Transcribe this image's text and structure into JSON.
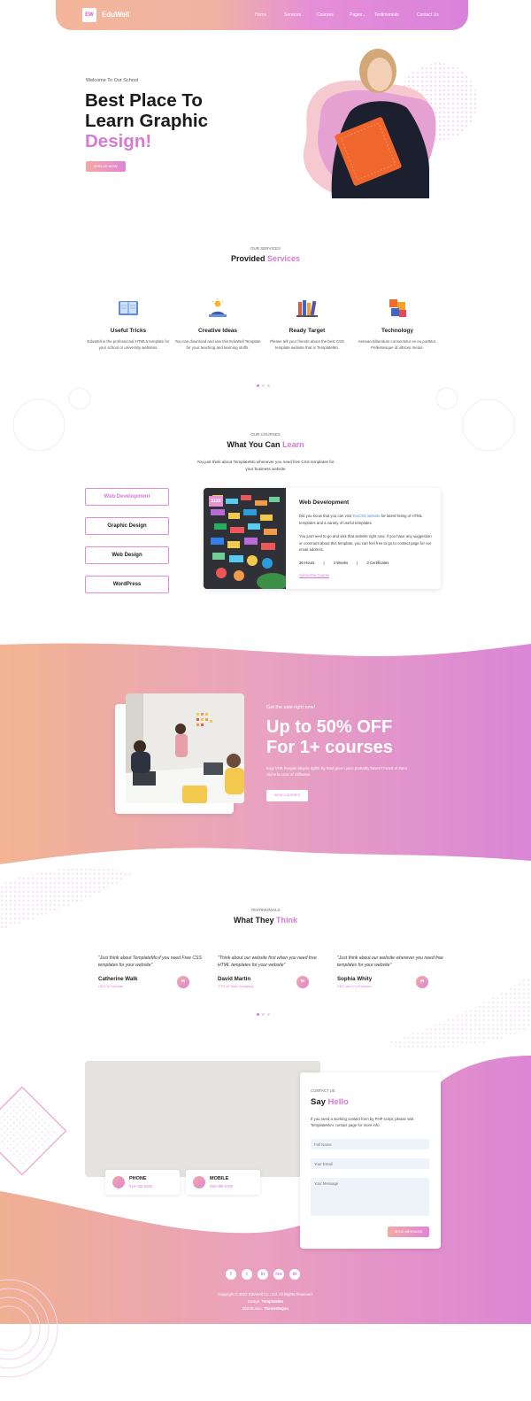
{
  "header": {
    "logo_mark": "EW",
    "brand": "EduWell",
    "nav": [
      "Home",
      "Services",
      "Courses",
      "Pages",
      "Testimonials",
      "Contact Us"
    ]
  },
  "hero": {
    "kicker": "Welcome To Our School",
    "title_line1": "Best Place To",
    "title_line2": "Learn Graphic",
    "title_highlight": "Design!",
    "button": "JOIN US NOW!"
  },
  "services": {
    "kicker": "OUR SERVICES",
    "title": "Provided",
    "title_highlight": "Services",
    "items": [
      {
        "icon": "book-icon",
        "title": "Useful Tricks",
        "text": "EduWell is the professional HTML5 template for your school or university websites."
      },
      {
        "icon": "presentation-icon",
        "title": "Creative Ideas",
        "text": "You can download and use this EduWell Template for your teaching and learning stuffs."
      },
      {
        "icon": "books-icon",
        "title": "Ready Target",
        "text": "Please tell your friends about the best CSS template website that is TemplateMo."
      },
      {
        "icon": "puzzle-icon",
        "title": "Technology",
        "text": "Aenean bibendum consectetur ex eu porttitor. Pellentesque id ultrices metus."
      }
    ]
  },
  "courses": {
    "kicker": "OUR COURSES",
    "title": "What You Can",
    "title_highlight": "Learn",
    "desc_line1": "You just think about TemplateMo whenever you need free CSS templates for",
    "desc_line2": "your business website",
    "tabs": [
      "Web Development",
      "Graphic Design",
      "Web Design",
      "WordPress"
    ],
    "card": {
      "price": "$128",
      "title": "Web Development",
      "p1_pre": "Did you know that you can visit ",
      "p1_link": "TooCSS website",
      "p1_post": " for latest listing of HTML templates and a variety of useful templates.",
      "p2": "You just need to go and visit that website right now. If you have any suggestion or comment about this template, you can feel free to go to contact page for our email address.",
      "stats": [
        "36 Hours",
        "4 Weeks",
        "3 Certificates"
      ],
      "link": "Subscribe Course"
    }
  },
  "promo": {
    "kicker": "Get the sale right now!",
    "title_line1": "Up to 50% OFF",
    "title_line2": "For 1+ courses",
    "text": "Kogi VHS freegan bicycle rights try-hard green juice probably haven't heard of them cliche la croix af chillwave.",
    "button": "VIEW COURSES"
  },
  "testimonials": {
    "kicker": "TESTIMONIALS",
    "title": "What They",
    "title_highlight": "Think",
    "items": [
      {
        "quote": "\"Just think about TemplateMo if you need Free CSS templates for your website\"",
        "name": "Catherine Walk",
        "role": "CEO & Founder"
      },
      {
        "quote": "\"Think about our website first when you need free HTML templates for your website\"",
        "name": "David Martin",
        "role": "CTO of Tech Company"
      },
      {
        "quote": "\"Just think about our website wherever you need free templates for your website\"",
        "name": "Sophia Whity",
        "role": "CEO and Co-Founder"
      }
    ]
  },
  "contact": {
    "phone_label": "PHONE",
    "phone_value": "010-020-0340",
    "mobile_label": "MOBILE",
    "mobile_value": "090-080-0760",
    "kicker": "CONTACT US",
    "title": "Say",
    "title_highlight": "Hello",
    "text": "If you need a working contact form by PHP script, please visit TemplateMo's contact page for more info.",
    "name_placeholder": "Full Name",
    "email_placeholder": "Your Email",
    "message_placeholder": "Your Message",
    "send": "SEND MESSAGE"
  },
  "footer": {
    "social": [
      "f",
      "t",
      "in",
      "rss",
      "dr"
    ],
    "copyright": "Copyright © 2022 EduWell Co., Ltd. All Rights Reserved.",
    "design_label": "Design:",
    "design_by": "TemplateMo",
    "dist_label": "Distribution:",
    "dist_by": "ThemeWagon"
  },
  "colors": {
    "accent": "#d77ad6",
    "peach": "#f3b69a",
    "link": "#4b8de6"
  }
}
